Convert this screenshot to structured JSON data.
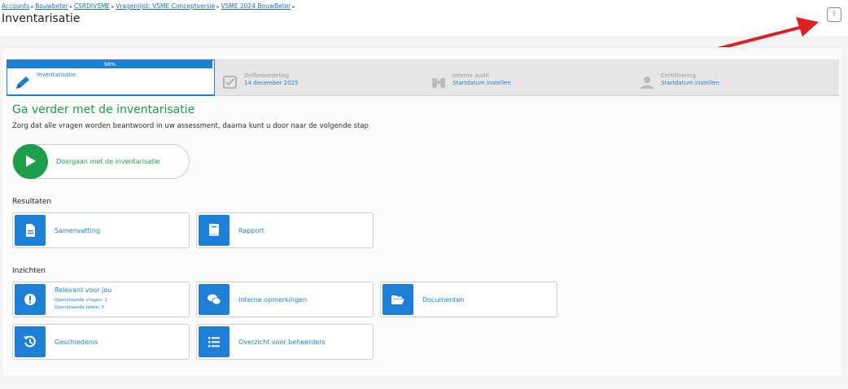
{
  "breadcrumb": [
    "Accounts",
    "Bouwbeter",
    "CSRDIVSME",
    "Vragenlijst: VSME Conceptversie",
    "VSME 2024 BouwBeter"
  ],
  "header": {
    "title": "Inventarisatie",
    "menu_label": "⁝"
  },
  "steps": [
    {
      "title": "Inventarisatie",
      "subtitle": "",
      "progress_label": "98%",
      "progress": 0.98,
      "active": true,
      "icon": "pencil-icon"
    },
    {
      "title": "Zelfbeoordeling",
      "subtitle": "14 december 2025",
      "active": false,
      "icon": "checkbox-icon"
    },
    {
      "title": "Interne audit",
      "subtitle": "Startdatum instellen",
      "active": false,
      "icon": "binoculars-icon"
    },
    {
      "title": "Certificering",
      "subtitle": "Startdatum instellen",
      "active": false,
      "icon": "certificate-user-icon"
    }
  ],
  "main": {
    "heading": "Ga verder met de inventarisatie",
    "intro": "Zorg dat alle vragen worden beantwoord in uw assessment, daarna kunt u door naar de volgende stap",
    "continue_label": "Doorgaan met de inventarisatie"
  },
  "results": {
    "label": "Resultaten",
    "tiles": [
      {
        "label": "Samenvatting",
        "icon": "document-icon"
      },
      {
        "label": "Rapport",
        "icon": "book-icon"
      }
    ]
  },
  "insights": {
    "label": "Inzichten",
    "tiles": [
      {
        "label": "Relevant voor jou",
        "sub1": "Openstaande vragen: 1",
        "sub2": "Openstaande taken: 0",
        "icon": "alert-icon"
      },
      {
        "label": "Interne opmerkingen",
        "icon": "comments-icon"
      },
      {
        "label": "Documenten",
        "icon": "folder-open-icon"
      },
      {
        "label": "Geschiedenis",
        "icon": "history-icon"
      },
      {
        "label": "Overzicht voor beheerders",
        "icon": "list-icon"
      }
    ]
  },
  "colors": {
    "primary": "#1e7fd6",
    "success": "#1e9e4a",
    "annotation_arrow": "#e02020"
  }
}
